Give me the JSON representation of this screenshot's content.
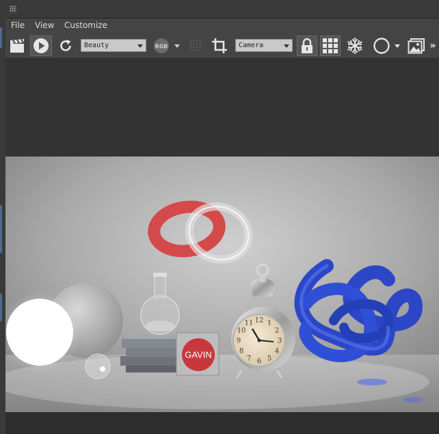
{
  "menu": {
    "items": [
      {
        "label": "File"
      },
      {
        "label": "View"
      },
      {
        "label": "Customize"
      }
    ]
  },
  "toolbar": {
    "render_channel": "Beauty",
    "color_mode": "RGB",
    "camera": "Camera",
    "overflow": "»"
  },
  "render": {
    "box_label": "GAVIN",
    "clock_numbers": [
      "12",
      "1",
      "2",
      "3",
      "4",
      "5",
      "6",
      "7",
      "8",
      "9",
      "10",
      "11"
    ]
  },
  "colors": {
    "panel": "#444444",
    "viewport_bg": "#333333",
    "torus_red": "#d44a4a",
    "knot_blue": "#2b47c8",
    "badge_red": "#c8373b"
  }
}
